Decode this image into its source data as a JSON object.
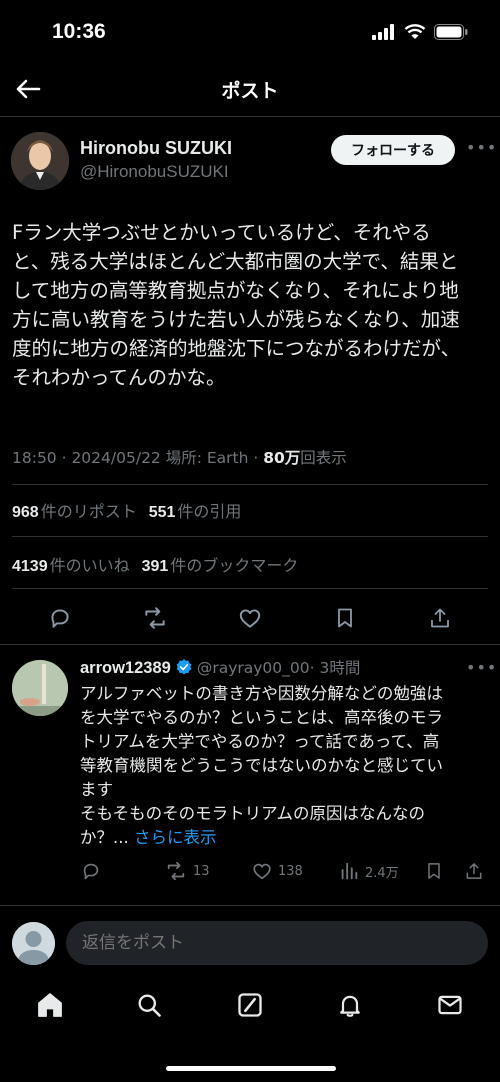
{
  "status": {
    "time": "10:36"
  },
  "header": {
    "title": "ポスト"
  },
  "author": {
    "name": "Hironobu SUZUKI",
    "handle": "@HironobuSUZUKI",
    "follow_label": "フォローする"
  },
  "tweet": {
    "lines": [
      "Fラン大学つぶせとかいっているけど、それやる",
      "と、残る大学はほとんど大都市圏の大学で、結果と",
      "して地方の高等教育拠点がなくなり、それにより地",
      "方に高い教育をうけた若い人が残らなくなり、加速",
      "度的に地方の経済的地盤沈下につながるわけだが、",
      "それわかってんのかな。"
    ],
    "meta_prefix": "18:50 · 2024/05/22 場所: Earth · ",
    "views_count": "80万",
    "views_label": "回表示"
  },
  "stats": {
    "reposts_count": "968",
    "reposts_label": "件のリポスト",
    "quotes_count": "551",
    "quotes_label": "件の引用",
    "likes_count": "4139",
    "likes_label": "件のいいね",
    "bookmarks_count": "391",
    "bookmarks_label": "件のブックマーク"
  },
  "reply": {
    "name": "arrow12389",
    "handle": "@rayray00_00",
    "time": "· 3時間",
    "lines": [
      "アルファベットの書き方や因数分解などの勉強は",
      "を大学でやるのか？ということは、高卒後のモラ",
      "トリアムを大学でやるのか？って話であって、高",
      "等教育機関をどうこうではないのかなと感じてい",
      "ます",
      "そもそものそのモラトリアムの原因はなんなの"
    ],
    "last_line": "か？... ",
    "show_more": "さらに表示",
    "retweets": "13",
    "likes": "138",
    "views": "2.4万"
  },
  "composer": {
    "placeholder": "返信をポスト"
  },
  "colors": {
    "accent": "#1d9bf0",
    "background": "#000000",
    "muted": "#71767b"
  }
}
